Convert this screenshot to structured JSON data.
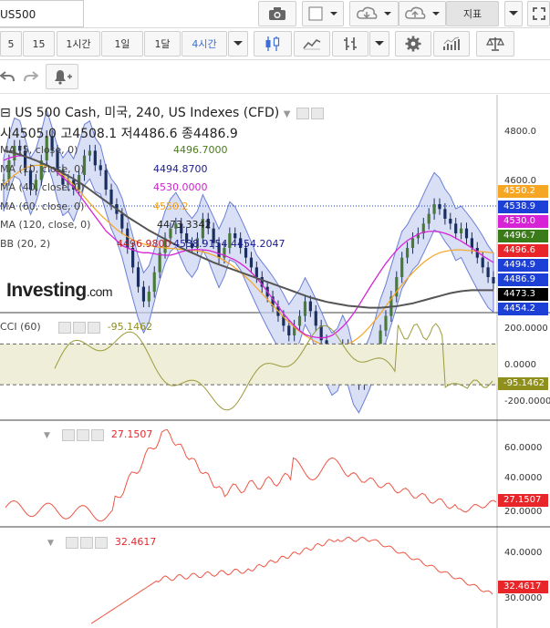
{
  "toolbar": {
    "symbol": "US500",
    "indicators_label": "지표",
    "intervals": [
      "5",
      "15",
      "1시간",
      "1일",
      "1달",
      "4시간"
    ],
    "active_interval": "4시간"
  },
  "chart_header": {
    "title": "US 500 Cash, 미국, 240, US Indexes (CFD)",
    "ohlc": "시4505.0 고4508.1 저4486.6 종4486.9"
  },
  "legend": {
    "ma5": {
      "label": "MA (5, close, 0)",
      "value": "4496.7000",
      "color": "#4a7a1e"
    },
    "ma10": {
      "label": "MA (10, close, 0)",
      "value": "4494.8700",
      "color": "#1a1a8c"
    },
    "ma40": {
      "label": "MA (40, close, 0)",
      "value": "4530.0000",
      "color": "#cc22cc"
    },
    "ma60": {
      "label": "MA (60, close, 0)",
      "value": "4550.2",
      "color": "#f5a623"
    },
    "ma120": {
      "label": "MA (120, close, 0)",
      "value": "4473.3342",
      "color": "#222222"
    },
    "bb": {
      "label": "BB (20, 2)",
      "values": [
        "4496.9800",
        "4538.9154",
        "4454.2047"
      ]
    }
  },
  "brand": {
    "name": "Investing",
    "suffix": ".com"
  },
  "price_axis": {
    "ticks": [
      "4800.0",
      "4600.0"
    ],
    "tags": [
      {
        "text": "4550.2",
        "color": "#f5a623"
      },
      {
        "text": "4538.9",
        "color": "#1c3fd6"
      },
      {
        "text": "4530.0",
        "color": "#d623d6"
      },
      {
        "text": "4496.7",
        "color": "#3b7a18"
      },
      {
        "text": "4496.6",
        "color": "#e8262a"
      },
      {
        "text": "4494.9",
        "color": "#1c3fd6"
      },
      {
        "text": "4486.9",
        "color": "#1c3fd6"
      },
      {
        "text": "4473.3",
        "color": "#000000"
      },
      {
        "text": "4454.2",
        "color": "#1c3fd6"
      }
    ]
  },
  "cci": {
    "label": "CCI (60)",
    "value": "-95.1462",
    "ticks": [
      "200.0000",
      "0.0000",
      "-200.0000"
    ],
    "tag_color": "#8f8f1e"
  },
  "panel2": {
    "value": "27.1507",
    "ticks": [
      "60.0000",
      "40.0000",
      "20.0000"
    ],
    "tag_color": "#e8262a"
  },
  "panel3": {
    "value": "32.4617",
    "ticks": [
      "40.0000",
      "30.0000"
    ],
    "tag_color": "#e8262a"
  },
  "chart_data": {
    "type": "line",
    "price": {
      "ylim": [
        4440,
        4830
      ],
      "close": [
        4700,
        4740,
        4770,
        4760,
        4720,
        4680,
        4700,
        4740,
        4790,
        4760,
        4720,
        4690,
        4700,
        4680,
        4710,
        4750,
        4760,
        4730,
        4720,
        4680,
        4650,
        4630,
        4600,
        4560,
        4520,
        4480,
        4450,
        4470,
        4510,
        4550,
        4580,
        4600,
        4610,
        4590,
        4570,
        4560,
        4580,
        4620,
        4600,
        4570,
        4540,
        4560,
        4590,
        4580,
        4560,
        4540,
        4520,
        4500,
        4480,
        4460,
        4440,
        4420,
        4400,
        4380,
        4400,
        4420,
        4450,
        4430,
        4400,
        4370,
        4340,
        4320,
        4330,
        4360,
        4340,
        4300,
        4280,
        4300,
        4320,
        4350,
        4390,
        4420,
        4460,
        4500,
        4540,
        4560,
        4580,
        4590,
        4610,
        4630,
        4650,
        4640,
        4620,
        4610,
        4590,
        4600,
        4580,
        4560,
        4540,
        4520,
        4500,
        4487
      ],
      "ma40": [
        4740,
        4745,
        4748,
        4750,
        4748,
        4745,
        4740,
        4735,
        4730,
        4725,
        4715,
        4705,
        4695,
        4685,
        4670,
        4655,
        4640,
        4625,
        4610,
        4595,
        4585,
        4575,
        4565,
        4560,
        4556,
        4552,
        4550,
        4550,
        4548,
        4546,
        4545,
        4545,
        4548,
        4552,
        4555,
        4556,
        4557,
        4556,
        4555,
        4552,
        4548,
        4545,
        4540,
        4535,
        4528,
        4520,
        4510,
        4498,
        4485,
        4470,
        4455,
        4440,
        4425,
        4412,
        4400,
        4390,
        4382,
        4378,
        4376,
        4375,
        4376,
        4380,
        4388,
        4398,
        4410,
        4425,
        4442,
        4460,
        4478,
        4495,
        4512,
        4528,
        4542,
        4555,
        4566,
        4575,
        4582,
        4588,
        4592,
        4594,
        4594,
        4593,
        4590,
        4586,
        4580,
        4574,
        4567,
        4560,
        4552,
        4544,
        4537,
        4530
      ],
      "ma60": [
        4690,
        4700,
        4710,
        4718,
        4724,
        4728,
        4730,
        4730,
        4728,
        4724,
        4718,
        4710,
        4700,
        4690,
        4678,
        4665,
        4652,
        4640,
        4628,
        4618,
        4608,
        4598,
        4590,
        4583,
        4577,
        4572,
        4568,
        4565,
        4563,
        4561,
        4560,
        4559,
        4558,
        4557,
        4556,
        4555,
        4554,
        4552,
        4549,
        4545,
        4540,
        4534,
        4527,
        4519,
        4510,
        4500,
        4490,
        4478,
        4466,
        4454,
        4442,
        4430,
        4418,
        4407,
        4397,
        4388,
        4380,
        4373,
        4367,
        4362,
        4358,
        4356,
        4356,
        4358,
        4362,
        4368,
        4376,
        4386,
        4398,
        4411,
        4425,
        4440,
        4455,
        4470,
        4484,
        4497,
        4509,
        4520,
        4530,
        4538,
        4545,
        4550,
        4553,
        4555,
        4556,
        4556,
        4555,
        4554,
        4553,
        4552,
        4551,
        4550
      ],
      "ma120": [
        4760,
        4758,
        4755,
        4752,
        4748,
        4744,
        4740,
        4735,
        4730,
        4725,
        4720,
        4714,
        4708,
        4702,
        4695,
        4688,
        4680,
        4672,
        4664,
        4656,
        4648,
        4640,
        4632,
        4624,
        4617,
        4610,
        4603,
        4596,
        4590,
        4584,
        4578,
        4572,
        4566,
        4560,
        4555,
        4550,
        4545,
        4540,
        4535,
        4530,
        4526,
        4522,
        4518,
        4514,
        4510,
        4506,
        4502,
        4498,
        4494,
        4490,
        4486,
        4482,
        4478,
        4474,
        4470,
        4466,
        4462,
        4458,
        4455,
        4452,
        4449,
        4447,
        4445,
        4443,
        4441,
        4440,
        4439,
        4438,
        4437,
        4437,
        4437,
        4438,
        4439,
        4440,
        4442,
        4444,
        4446,
        4449,
        4452,
        4455,
        4458,
        4461,
        4464,
        4467,
        4469,
        4471,
        4472,
        4473,
        4473,
        4473,
        4473,
        4473
      ]
    },
    "cci": {
      "ylim": [
        -260,
        240
      ],
      "bands": [
        100,
        -100
      ],
      "last": -95.1462
    },
    "panel2": {
      "ylim": [
        15,
        70
      ],
      "last": 27.1507
    },
    "panel3": {
      "ylim": [
        25,
        47
      ],
      "last": 32.4617
    }
  }
}
